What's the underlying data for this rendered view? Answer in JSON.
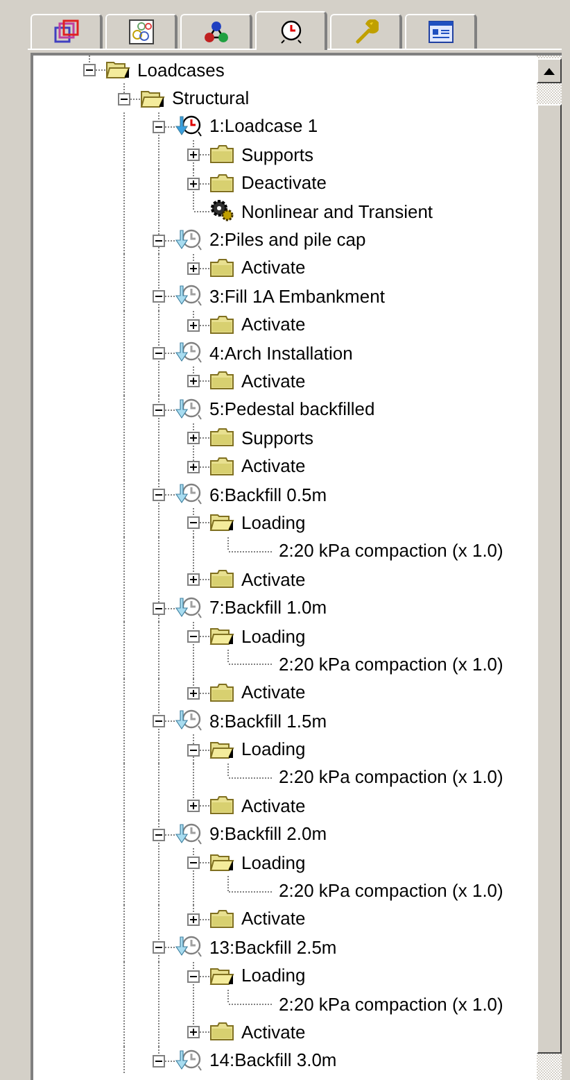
{
  "tabs": [
    {
      "kind": "layers",
      "selected": false
    },
    {
      "kind": "groups",
      "selected": false
    },
    {
      "kind": "nodes",
      "selected": false
    },
    {
      "kind": "clock",
      "selected": true
    },
    {
      "kind": "wrench",
      "selected": false
    },
    {
      "kind": "form",
      "selected": false
    }
  ],
  "tree": [
    {
      "label": "Loadcases",
      "kind": "folder",
      "expanded": true,
      "children": [
        {
          "label": "Structural",
          "kind": "folder",
          "expanded": true,
          "children": [
            {
              "label": "1:Loadcase 1",
              "kind": "loadcase",
              "current": true,
              "expanded": true,
              "children": [
                {
                  "label": "Supports",
                  "kind": "folder",
                  "expanded": false
                },
                {
                  "label": "Deactivate",
                  "kind": "folder",
                  "expanded": false
                },
                {
                  "label": "Nonlinear and Transient",
                  "kind": "gears"
                }
              ]
            },
            {
              "label": "2:Piles and pile cap",
              "kind": "loadcase",
              "current": false,
              "expanded": true,
              "children": [
                {
                  "label": "Activate",
                  "kind": "folder",
                  "expanded": false
                }
              ]
            },
            {
              "label": "3:Fill 1A Embankment",
              "kind": "loadcase",
              "current": false,
              "expanded": true,
              "children": [
                {
                  "label": "Activate",
                  "kind": "folder",
                  "expanded": false
                }
              ]
            },
            {
              "label": "4:Arch Installation",
              "kind": "loadcase",
              "current": false,
              "expanded": true,
              "children": [
                {
                  "label": "Activate",
                  "kind": "folder",
                  "expanded": false
                }
              ]
            },
            {
              "label": "5:Pedestal backfilled",
              "kind": "loadcase",
              "current": false,
              "expanded": true,
              "children": [
                {
                  "label": "Supports",
                  "kind": "folder",
                  "expanded": false
                },
                {
                  "label": "Activate",
                  "kind": "folder",
                  "expanded": false
                }
              ]
            },
            {
              "label": "6:Backfill 0.5m",
              "kind": "loadcase",
              "current": false,
              "expanded": true,
              "children": [
                {
                  "label": "Loading",
                  "kind": "folder",
                  "expanded": true,
                  "children": [
                    {
                      "label": "2:20 kPa compaction (x 1.0)",
                      "kind": "entry"
                    }
                  ]
                },
                {
                  "label": "Activate",
                  "kind": "folder",
                  "expanded": false
                }
              ]
            },
            {
              "label": "7:Backfill 1.0m",
              "kind": "loadcase",
              "current": false,
              "expanded": true,
              "children": [
                {
                  "label": "Loading",
                  "kind": "folder",
                  "expanded": true,
                  "children": [
                    {
                      "label": "2:20 kPa compaction (x 1.0)",
                      "kind": "entry"
                    }
                  ]
                },
                {
                  "label": "Activate",
                  "kind": "folder",
                  "expanded": false
                }
              ]
            },
            {
              "label": "8:Backfill 1.5m",
              "kind": "loadcase",
              "current": false,
              "expanded": true,
              "children": [
                {
                  "label": "Loading",
                  "kind": "folder",
                  "expanded": true,
                  "children": [
                    {
                      "label": "2:20 kPa compaction (x 1.0)",
                      "kind": "entry"
                    }
                  ]
                },
                {
                  "label": "Activate",
                  "kind": "folder",
                  "expanded": false
                }
              ]
            },
            {
              "label": "9:Backfill 2.0m",
              "kind": "loadcase",
              "current": false,
              "expanded": true,
              "children": [
                {
                  "label": "Loading",
                  "kind": "folder",
                  "expanded": true,
                  "children": [
                    {
                      "label": "2:20 kPa compaction (x 1.0)",
                      "kind": "entry"
                    }
                  ]
                },
                {
                  "label": "Activate",
                  "kind": "folder",
                  "expanded": false
                }
              ]
            },
            {
              "label": "13:Backfill 2.5m",
              "kind": "loadcase",
              "current": false,
              "expanded": true,
              "children": [
                {
                  "label": "Loading",
                  "kind": "folder",
                  "expanded": true,
                  "children": [
                    {
                      "label": "2:20 kPa compaction (x 1.0)",
                      "kind": "entry"
                    }
                  ]
                },
                {
                  "label": "Activate",
                  "kind": "folder",
                  "expanded": false
                }
              ]
            },
            {
              "label": "14:Backfill 3.0m",
              "kind": "loadcase",
              "current": false,
              "expanded": true
            }
          ]
        }
      ]
    }
  ]
}
